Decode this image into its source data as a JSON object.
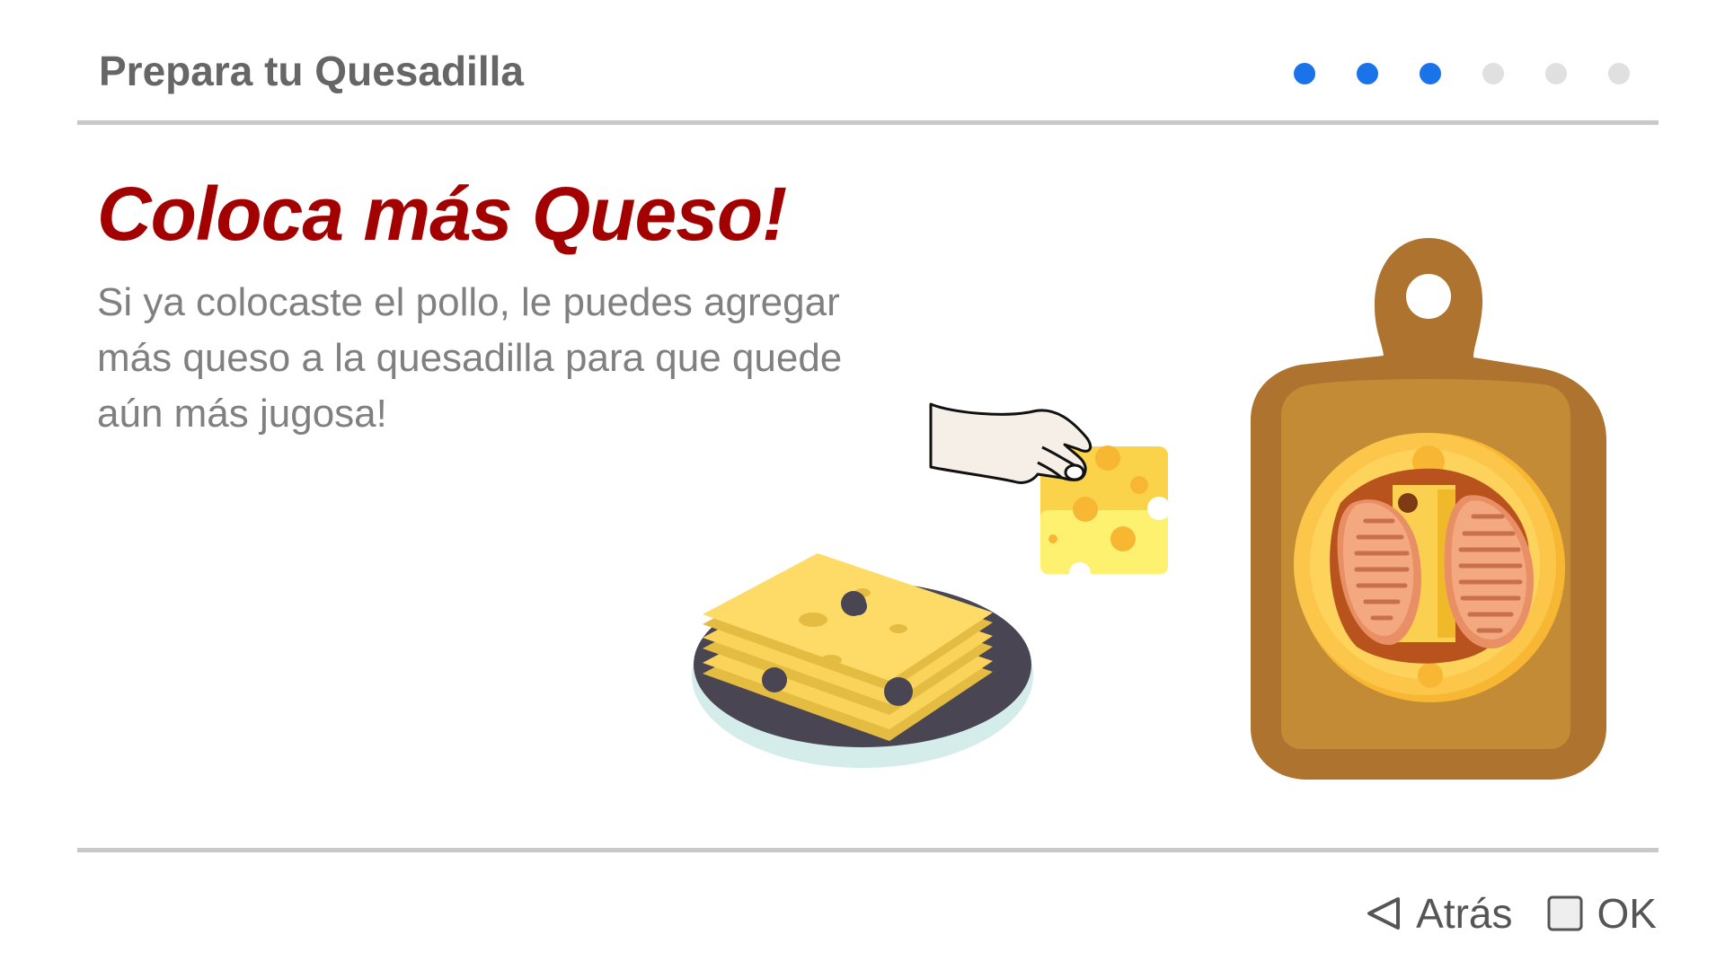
{
  "header": {
    "title": "Prepara tu Quesadilla",
    "progress": {
      "total_steps": 6,
      "current_step": 3
    }
  },
  "step": {
    "title": "Coloca más Queso!",
    "description": "Si ya colocaste el pollo, le puedes agregar más queso a la quesadilla para que quede aún más jugosa!"
  },
  "footer": {
    "back_label": "Atrás",
    "back_icon": "triangle-left-icon",
    "ok_label": "OK",
    "ok_icon": "square-icon"
  },
  "colors": {
    "accent": "#1a73e8",
    "title_red": "#a30000",
    "text_gray": "#808080"
  }
}
